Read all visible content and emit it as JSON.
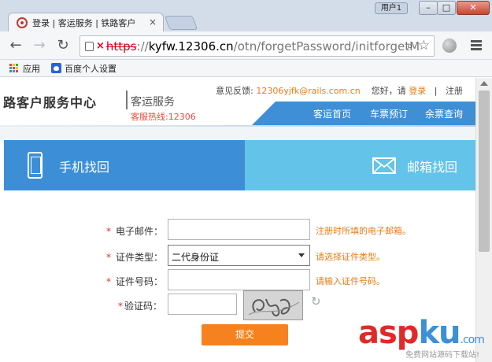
{
  "browser": {
    "tab_title": "登录 | 客运服务 | 铁路客户",
    "tab_close": "×",
    "user_badge": "用户1",
    "url_scheme": "https",
    "url_sep": "://",
    "url_host": "kyfw.12306.cn",
    "url_path": "/otn/forgetPassword/initforgetM",
    "bookmarks": [
      {
        "label": "应用",
        "icon": "apps-icon"
      },
      {
        "label": "百度个人设置",
        "icon": "baidu-icon"
      }
    ]
  },
  "header": {
    "logo_text": "路客户服务中心",
    "logo_sub": "客运服务",
    "hotline": "客服热线:12306",
    "feedback_label": "意见反馈:",
    "feedback_email": "12306yjfk@rails.com.cn",
    "greeting": "您好，请",
    "login_link": "登录",
    "separator": "|",
    "register_link": "注册",
    "nav": [
      "客运首页",
      "车票预订",
      "余票查询"
    ]
  },
  "tabs": {
    "phone": "手机找回",
    "mail": "邮箱找回"
  },
  "form": {
    "required_mark": "*",
    "email_label": "电子邮件：",
    "email_hint": "注册时所填的电子邮箱。",
    "idtype_label": "证件类型：",
    "idtype_value": "二代身份证",
    "idtype_hint": "请选择证件类型。",
    "idnum_label": "证件号码：",
    "idnum_hint": "请输入证件号码。",
    "captcha_label": "验证码：",
    "submit": "提交"
  },
  "watermark": {
    "asp": "asp",
    "ku": "ku",
    "com": ".com",
    "sub": "免费网站源码下载站!"
  },
  "colors": {
    "primary_blue": "#3c8fd6",
    "light_blue": "#63c3e9",
    "accent_orange": "#e87c14",
    "submit_orange": "#f6821f",
    "required_red": "#e03131"
  }
}
